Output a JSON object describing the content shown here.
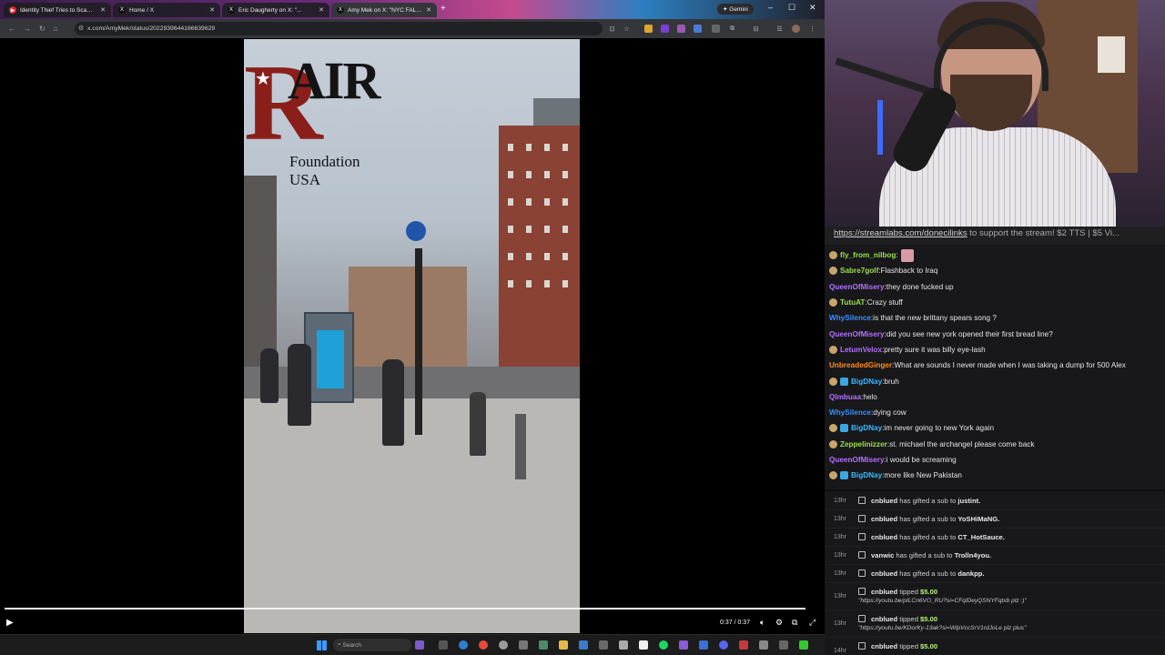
{
  "browser": {
    "tabs": [
      {
        "label": "Identity Thief Tries to Scam $4...",
        "favicon": "red-circle-icon",
        "active": false
      },
      {
        "label": "Home / X",
        "favicon": "x-logo-icon",
        "active": false
      },
      {
        "label": "Eric Daugherty on X: \"...",
        "favicon": "x-logo-icon",
        "active": false
      },
      {
        "label": "Amy Mek on X: \"NYC FALL...",
        "favicon": "x-logo-icon",
        "active": true
      }
    ],
    "gemini_label": "Gemini",
    "url": "x.com/AmyMek/status/2022939644166639629"
  },
  "video": {
    "logo_letter": "R",
    "logo_word": "AIR",
    "logo_subtitle": "Foundation USA",
    "timecode": "0:37 / 0:37",
    "progress": 1.0
  },
  "taskbar": {
    "search_placeholder": "Search"
  },
  "chat": {
    "ticker_link": "https://streamlabs.com/donecilinks",
    "ticker_text": " to support the stream! $2 TTS | $5 Vi...",
    "messages": [
      {
        "user": "fly_from_nilbog",
        "text": "",
        "color": "#9bde4a",
        "badge": "coin",
        "emote": true
      },
      {
        "user": "Sabre7golf",
        "text": "Flashback to Iraq",
        "color": "#9bde4a",
        "badge": "coin"
      },
      {
        "user": "QueenOfMisery",
        "text": "they done fucked up",
        "color": "#b470ff",
        "badge": ""
      },
      {
        "user": "TutuAT",
        "text": "Crazy stuff",
        "color": "#9bde4a",
        "badge": "coin"
      },
      {
        "user": "WhySilence",
        "text": "is that the new brittany spears song ?",
        "color": "#3a8fff",
        "badge": ""
      },
      {
        "user": "QueenOfMisery",
        "text": "did you see new york opened their first bread line?",
        "color": "#b470ff",
        "badge": ""
      },
      {
        "user": "LetumVelox",
        "text": "pretty sure it was billy eye-lash",
        "color": "#b470ff",
        "badge": "coin"
      },
      {
        "user": "UnbreadedGinger",
        "text": "What are sounds I never made when I was taking a dump for 500 Alex",
        "color": "#ff8a1e",
        "badge": ""
      },
      {
        "user": "BigDNay",
        "text": "bruh",
        "color": "#3ab8ff",
        "badge": "both"
      },
      {
        "user": "Qlmbuaa",
        "text": "helo",
        "color": "#b470ff",
        "badge": ""
      },
      {
        "user": "WhySilence",
        "text": "dying cow",
        "color": "#3a8fff",
        "badge": ""
      },
      {
        "user": "BigDNay",
        "text": "im never going to new York again",
        "color": "#3ab8ff",
        "badge": "both"
      },
      {
        "user": "Zeppelinizzer",
        "text": "st. michael the archangel please come back",
        "color": "#9bde4a",
        "badge": "coin"
      },
      {
        "user": "QueenOfMisery",
        "text": "i would be screaming",
        "color": "#b470ff",
        "badge": ""
      },
      {
        "user": "BigDNay",
        "text": "more like New Pakistan",
        "color": "#3ab8ff",
        "badge": "both"
      }
    ],
    "events": [
      {
        "time": "13hr",
        "user": "cnblued",
        "action": " has gifted a sub to ",
        "target": "justint."
      },
      {
        "time": "13hr",
        "user": "cnblued",
        "action": " has gifted a sub to ",
        "target": "YoSHiMaNG."
      },
      {
        "time": "13hr",
        "user": "cnblued",
        "action": " has gifted a sub to ",
        "target": "CT_HotSauce."
      },
      {
        "time": "13hr",
        "user": "vanwic",
        "action": " has gifted a sub to ",
        "target": "Trolln4you."
      },
      {
        "time": "13hr",
        "user": "cnblued",
        "action": " has gifted a sub to ",
        "target": "dankpp."
      }
    ],
    "tips": [
      {
        "time": "13hr",
        "user": "cnblued",
        "action": " tipped ",
        "amount": "$5.00",
        "link": "\"https://youtu.be/pILCn6VO_RU?si=CFqlDeyQSNYFqtxb plz :)\""
      },
      {
        "time": "13hr",
        "user": "cnblued",
        "action": " tipped ",
        "amount": "$5.00",
        "link": "\"https://youtu.be/KDorKy-13ak?si=WlpVccSrV1rdJoLe plz plus\""
      },
      {
        "time": "14hr",
        "user": "cnblued",
        "action": " tipped ",
        "amount": "$5.00",
        "link": ""
      }
    ]
  }
}
